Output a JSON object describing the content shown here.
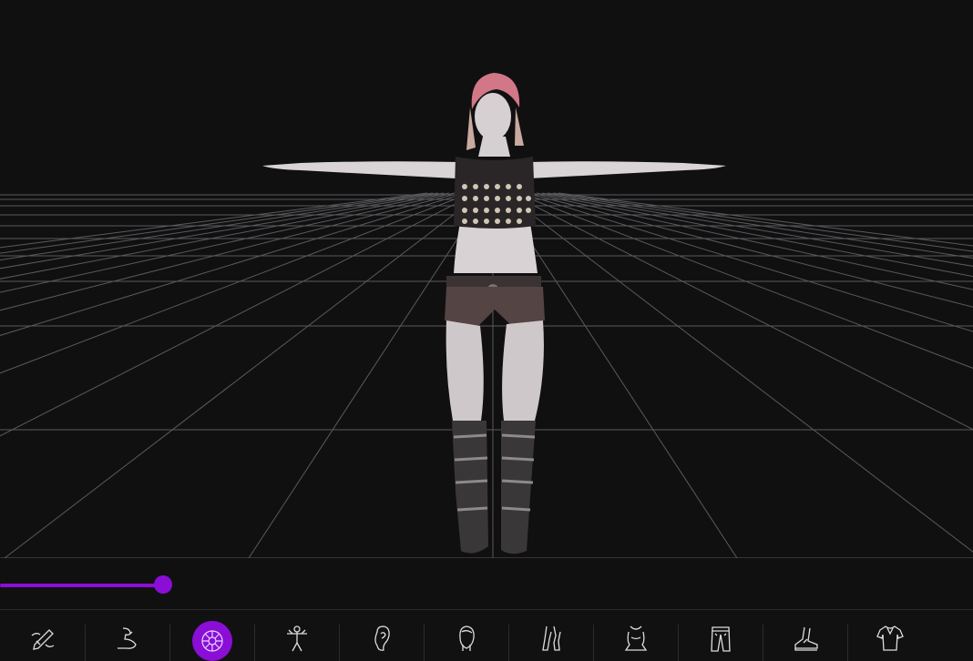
{
  "viewport": {
    "background": "#111011",
    "grid_color": "#5a595c",
    "show_grid": true
  },
  "timeline": {
    "progress": 0.168,
    "accent": "#8a0ed6"
  },
  "toolbar": {
    "accent": "#8a0ed6",
    "items": [
      {
        "icon": "edit-body-icon",
        "active": false
      },
      {
        "icon": "muscle-arm-icon",
        "active": false
      },
      {
        "icon": "skin-texture-wheel-icon",
        "active": true
      },
      {
        "icon": "body-proportions-icon",
        "active": false
      },
      {
        "icon": "ear-icon",
        "active": false
      },
      {
        "icon": "head-icon",
        "active": false
      },
      {
        "icon": "legs-icon",
        "active": false
      },
      {
        "icon": "torso-icon",
        "active": false
      },
      {
        "icon": "pants-icon",
        "active": false
      },
      {
        "icon": "shoe-icon",
        "active": false
      },
      {
        "icon": "shirt-icon",
        "active": false
      }
    ]
  }
}
